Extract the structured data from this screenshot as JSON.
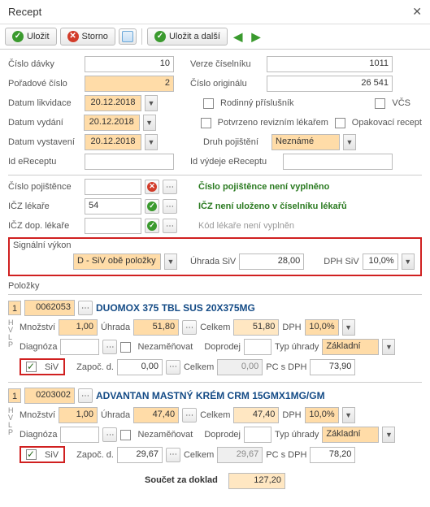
{
  "window": {
    "title": "Recept"
  },
  "toolbar": {
    "save": "Uložit",
    "cancel": "Storno",
    "save_next": "Uložit a další"
  },
  "header": {
    "cislo_davky_lbl": "Číslo dávky",
    "cislo_davky": "10",
    "verze_ciselniku_lbl": "Verze číselníku",
    "verze_ciselniku": "1011",
    "poradove_cislo_lbl": "Pořadové číslo",
    "poradove_cislo": "2",
    "cislo_originalu_lbl": "Číslo originálu",
    "cislo_originalu": "26 541",
    "datum_likvidace_lbl": "Datum likvidace",
    "datum_likvidace": "20.12.2018",
    "rodinny_lbl": "Rodinný příslušník",
    "vcs_lbl": "VČS",
    "datum_vydani_lbl": "Datum vydání",
    "datum_vydani": "20.12.2018",
    "potvrzeno_lbl": "Potvrzeno revizním lékařem",
    "opakovaci_lbl": "Opakovací recept",
    "datum_vystaveni_lbl": "Datum vystavení",
    "datum_vystaveni": "20.12.2018",
    "druh_pojisteni_lbl": "Druh pojištění",
    "druh_pojisteni": "Neznámé",
    "id_ereceptu_lbl": "Id eReceptu",
    "id_ereceptu": "",
    "id_vydeje_lbl": "Id výdeje eReceptu",
    "id_vydeje": ""
  },
  "validace": {
    "cislo_pojistence_lbl": "Číslo pojištěnce",
    "cislo_pojistence": "",
    "cislo_pojistence_msg": "Číslo pojištěnce není vyplněno",
    "icz_lekare_lbl": "IČZ lékaře",
    "icz_lekare": "54",
    "icz_lekare_msg": "IČZ není uloženo v číselníku lékařů",
    "icz_dop_lbl": "IČZ dop. lékaře",
    "icz_dop": "",
    "icz_dop_msg": "Kód lékaře není vyplněn"
  },
  "signalni": {
    "lbl": "Signální výkon",
    "typ": "D - SiV obě položky",
    "uhrada_lbl": "Úhrada SiV",
    "uhrada": "28,00",
    "dph_lbl": "DPH SiV",
    "dph": "10,0%"
  },
  "polozky_lbl": "Položky",
  "polozky": [
    {
      "num": "1",
      "code": "0062053",
      "name": "DUOMOX 375 TBL SUS 20X375MG",
      "mnozstvi_lbl": "Množství",
      "mnozstvi": "1,00",
      "uhrada_lbl": "Úhrada",
      "uhrada": "51,80",
      "celkem_lbl": "Celkem",
      "celkem": "51,80",
      "dph_lbl": "DPH",
      "dph": "10,0%",
      "diagnoza_lbl": "Diagnóza",
      "diagnoza": "",
      "nezamenovat_lbl": "Nezaměňovat",
      "doprodej_lbl": "Doprodej",
      "doprodej": "",
      "typ_uhrady_lbl": "Typ úhrady",
      "typ_uhrady": "Základní",
      "siv_lbl": "SiV",
      "zapoc_lbl": "Započ. d.",
      "zapoc": "0,00",
      "celkem2_lbl": "Celkem",
      "celkem2": "0,00",
      "pc_lbl": "PC s DPH",
      "pc": "73,90"
    },
    {
      "num": "1",
      "code": "0203002",
      "name": "ADVANTAN MASTNÝ KRÉM CRM 15GMX1MG/GM",
      "mnozstvi_lbl": "Množství",
      "mnozstvi": "1,00",
      "uhrada_lbl": "Úhrada",
      "uhrada": "47,40",
      "celkem_lbl": "Celkem",
      "celkem": "47,40",
      "dph_lbl": "DPH",
      "dph": "10,0%",
      "diagnoza_lbl": "Diagnóza",
      "diagnoza": "",
      "nezamenovat_lbl": "Nezaměňovat",
      "doprodej_lbl": "Doprodej",
      "doprodej": "",
      "typ_uhrady_lbl": "Typ úhrady",
      "typ_uhrady": "Základní",
      "siv_lbl": "SiV",
      "zapoc_lbl": "Započ. d.",
      "zapoc": "29,67",
      "celkem2_lbl": "Celkem",
      "celkem2": "29,67",
      "pc_lbl": "PC s DPH",
      "pc": "78,20"
    }
  ],
  "footer": {
    "soucet_lbl": "Součet za doklad",
    "soucet": "127,20"
  }
}
